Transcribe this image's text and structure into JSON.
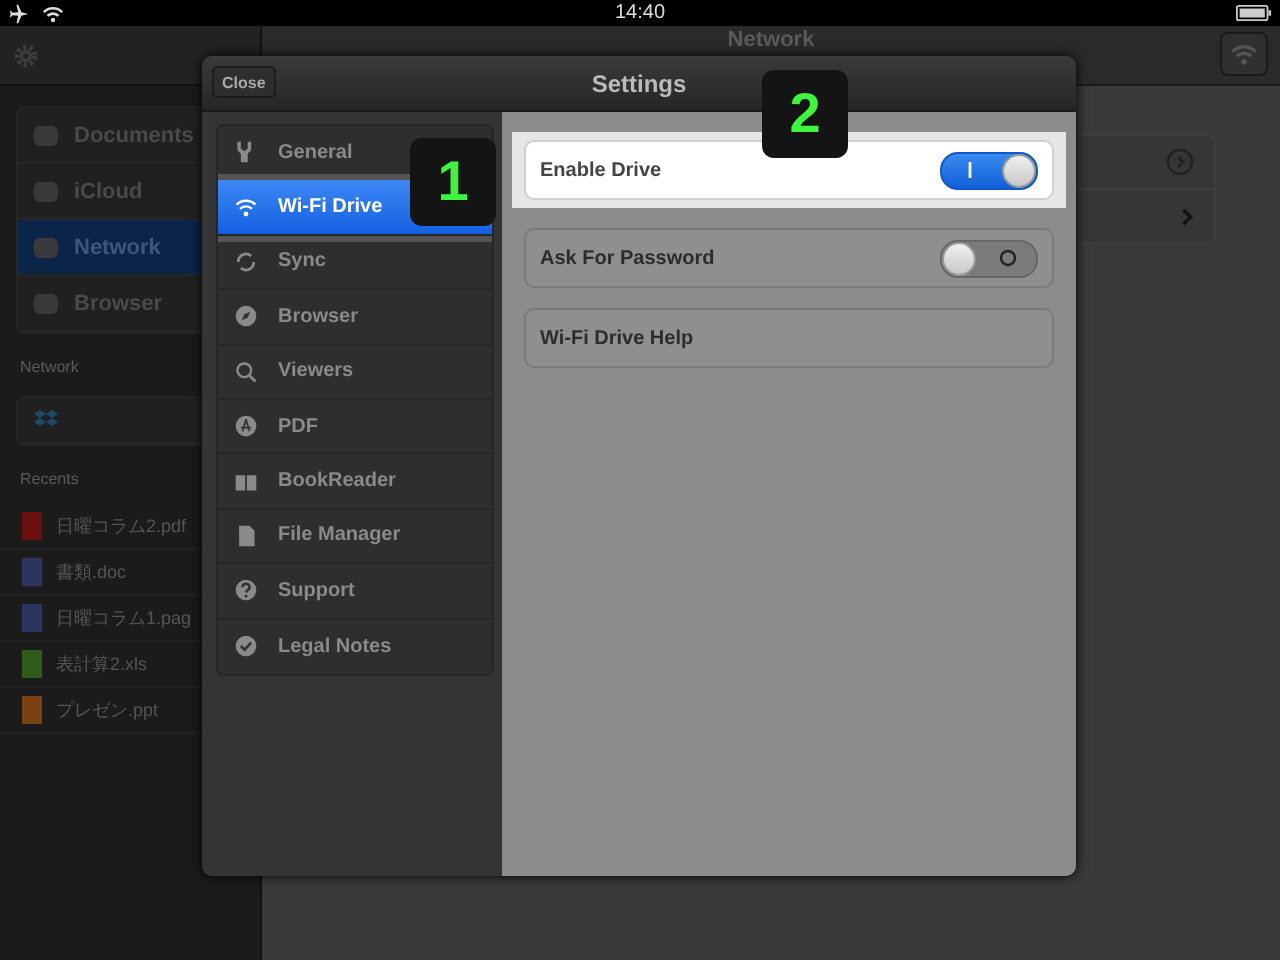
{
  "status_bar": {
    "time": "14:40"
  },
  "background": {
    "title": "Network",
    "sidebar": [
      {
        "label": "Documents",
        "selected": false
      },
      {
        "label": "iCloud",
        "selected": false
      },
      {
        "label": "Network",
        "selected": true
      },
      {
        "label": "Browser",
        "selected": false
      }
    ],
    "network_title": "Network",
    "recents_title": "Recents",
    "recents": [
      {
        "name": "日曜コラム2.pdf",
        "kind": "pdf"
      },
      {
        "name": "書類.doc",
        "kind": "doc"
      },
      {
        "name": "日曜コラム1.pag",
        "kind": "doc"
      },
      {
        "name": "表計算2.xls",
        "kind": "xls"
      },
      {
        "name": "プレゼン.ppt",
        "kind": "ppt"
      }
    ]
  },
  "settings": {
    "title": "Settings",
    "close": "Close",
    "menu": [
      {
        "label": "General",
        "selected": false
      },
      {
        "label": "Wi-Fi Drive",
        "selected": true
      },
      {
        "label": "Sync",
        "selected": false
      },
      {
        "label": "Browser",
        "selected": false
      },
      {
        "label": "Viewers",
        "selected": false
      },
      {
        "label": "PDF",
        "selected": false
      },
      {
        "label": "BookReader",
        "selected": false
      },
      {
        "label": "File Manager",
        "selected": false
      },
      {
        "label": "Support",
        "selected": false
      },
      {
        "label": "Legal Notes",
        "selected": false
      }
    ],
    "options": [
      {
        "kind": "switch",
        "label": "Enable Drive",
        "on": true,
        "highlighted": true
      },
      {
        "kind": "switch",
        "label": "Ask For Password",
        "on": false,
        "highlighted": false
      },
      {
        "kind": "link",
        "label": "Wi-Fi Drive Help",
        "highlighted": false
      }
    ]
  },
  "callouts": [
    "1",
    "2"
  ]
}
